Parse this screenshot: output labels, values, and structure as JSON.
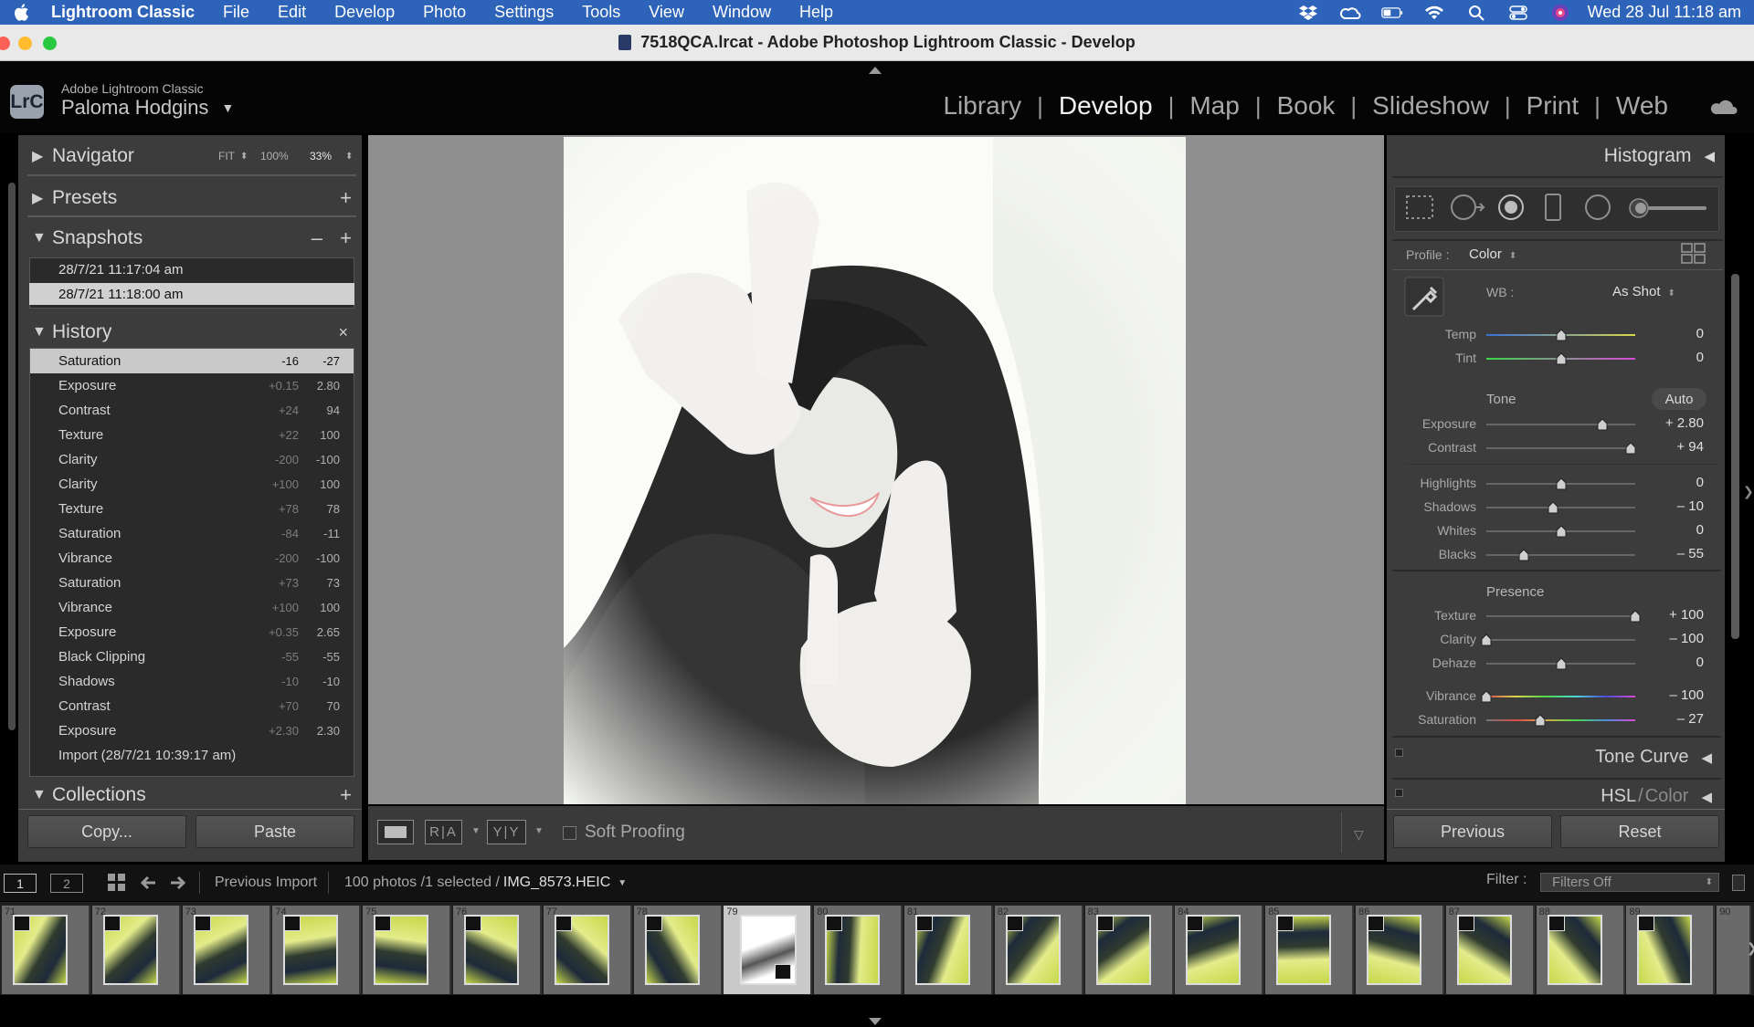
{
  "menubar": {
    "app_name": "Lightroom Classic",
    "items": [
      "File",
      "Edit",
      "Develop",
      "Photo",
      "Settings",
      "Tools",
      "View",
      "Window",
      "Help"
    ],
    "clock": "Wed 28 Jul  11:18 am"
  },
  "window": {
    "title": "7518QCA.lrcat - Adobe Photoshop Lightroom Classic - Develop"
  },
  "identity": {
    "logo": "LrC",
    "subtitle": "Adobe Lightroom Classic",
    "user_name": "Paloma Hodgins"
  },
  "modules": {
    "items": [
      "Library",
      "Develop",
      "Map",
      "Book",
      "Slideshow",
      "Print",
      "Web"
    ],
    "active": "Develop"
  },
  "left_panel": {
    "navigator": {
      "title": "Navigator",
      "fit": "FIT",
      "p100": "100%",
      "p33": "33%"
    },
    "presets": {
      "title": "Presets"
    },
    "snapshots": {
      "title": "Snapshots",
      "items": [
        "28/7/21 11:17:04 am",
        "28/7/21 11:18:00 am"
      ],
      "selected_index": 1
    },
    "history": {
      "title": "History",
      "items": [
        {
          "name": "Saturation",
          "delta": "-16",
          "value": "-27"
        },
        {
          "name": "Exposure",
          "delta": "+0.15",
          "value": "2.80"
        },
        {
          "name": "Contrast",
          "delta": "+24",
          "value": "94"
        },
        {
          "name": "Texture",
          "delta": "+22",
          "value": "100"
        },
        {
          "name": "Clarity",
          "delta": "-200",
          "value": "-100"
        },
        {
          "name": "Clarity",
          "delta": "+100",
          "value": "100"
        },
        {
          "name": "Texture",
          "delta": "+78",
          "value": "78"
        },
        {
          "name": "Saturation",
          "delta": "-84",
          "value": "-11"
        },
        {
          "name": "Vibrance",
          "delta": "-200",
          "value": "-100"
        },
        {
          "name": "Saturation",
          "delta": "+73",
          "value": "73"
        },
        {
          "name": "Vibrance",
          "delta": "+100",
          "value": "100"
        },
        {
          "name": "Exposure",
          "delta": "+0.35",
          "value": "2.65"
        },
        {
          "name": "Black Clipping",
          "delta": "-55",
          "value": "-55"
        },
        {
          "name": "Shadows",
          "delta": "-10",
          "value": "-10"
        },
        {
          "name": "Contrast",
          "delta": "+70",
          "value": "70"
        },
        {
          "name": "Exposure",
          "delta": "+2.30",
          "value": "2.30"
        },
        {
          "name": "Import (28/7/21 10:39:17 am)",
          "delta": "",
          "value": ""
        }
      ],
      "selected_index": 0
    },
    "collections": {
      "title": "Collections"
    },
    "copy_label": "Copy...",
    "paste_label": "Paste"
  },
  "toolbar": {
    "soft_proofing": "Soft Proofing"
  },
  "right_panel": {
    "histogram": {
      "title": "Histogram"
    },
    "profile": {
      "label": "Profile :",
      "value": "Color"
    },
    "wb": {
      "label": "WB :",
      "value": "As Shot"
    },
    "tone": {
      "title": "Tone",
      "auto": "Auto"
    },
    "presence": {
      "title": "Presence"
    },
    "sliders": [
      {
        "label": "Temp",
        "value": "0",
        "level": 0.5
      },
      {
        "label": "Tint",
        "value": "0",
        "level": 0.5
      },
      {
        "label": "Exposure",
        "value": "+ 2.80",
        "level": 0.78
      },
      {
        "label": "Contrast",
        "value": "+ 94",
        "level": 0.97
      },
      {
        "label": "Highlights",
        "value": "0",
        "level": 0.5
      },
      {
        "label": "Shadows",
        "value": "– 10",
        "level": 0.45
      },
      {
        "label": "Whites",
        "value": "0",
        "level": 0.5
      },
      {
        "label": "Blacks",
        "value": "– 55",
        "level": 0.25
      },
      {
        "label": "Texture",
        "value": "+ 100",
        "level": 1.0
      },
      {
        "label": "Clarity",
        "value": "– 100",
        "level": 0.0
      },
      {
        "label": "Dehaze",
        "value": "0",
        "level": 0.5
      },
      {
        "label": "Vibrance",
        "value": "– 100",
        "level": 0.0
      },
      {
        "label": "Saturation",
        "value": "– 27",
        "level": 0.36
      }
    ],
    "tone_curve": {
      "title": "Tone Curve"
    },
    "hsl": {
      "title_a": "HSL",
      "sep": "/",
      "title_b": "Color"
    },
    "previous_label": "Previous",
    "reset_label": "Reset"
  },
  "filmbar": {
    "page1": "1",
    "page2": "2",
    "source": "Previous Import",
    "info": "100 photos /1 selected /",
    "filename": "IMG_8573.HEIC",
    "filter_label": "Filter :",
    "filter_value": "Filters Off"
  },
  "filmstrip": {
    "numbers": [
      "71",
      "72",
      "73",
      "74",
      "75",
      "76",
      "77",
      "78",
      "79",
      "80",
      "81",
      "82",
      "83",
      "84",
      "85",
      "86",
      "87",
      "88",
      "89",
      "90"
    ],
    "selected_index": 8
  },
  "colors": {
    "menubar": "#2d63b8",
    "panel": "#3c3c3c",
    "canvas": "#8f8f8f",
    "thumb_green": "#c6d84a"
  }
}
